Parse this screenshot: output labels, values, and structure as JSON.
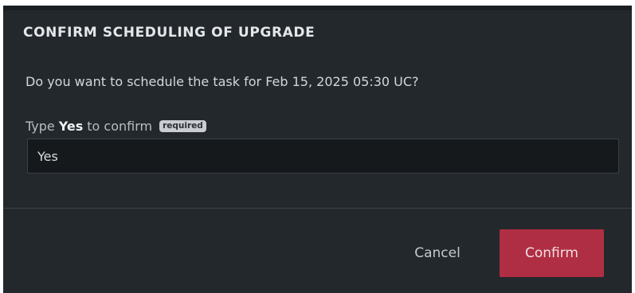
{
  "dialog": {
    "title": "CONFIRM SCHEDULING OF UPGRADE",
    "question": "Do you want to schedule the task for Feb 15, 2025 05:30 UC?",
    "confirm_prefix": "Type",
    "confirm_keyword": "Yes",
    "confirm_suffix": "to confirm",
    "required_badge": "required",
    "input_value": "Yes",
    "cancel_label": "Cancel",
    "confirm_label": "Confirm"
  },
  "colors": {
    "modal_background": "#23282c",
    "confirm_button": "#b02e43",
    "input_background": "#15191c"
  }
}
